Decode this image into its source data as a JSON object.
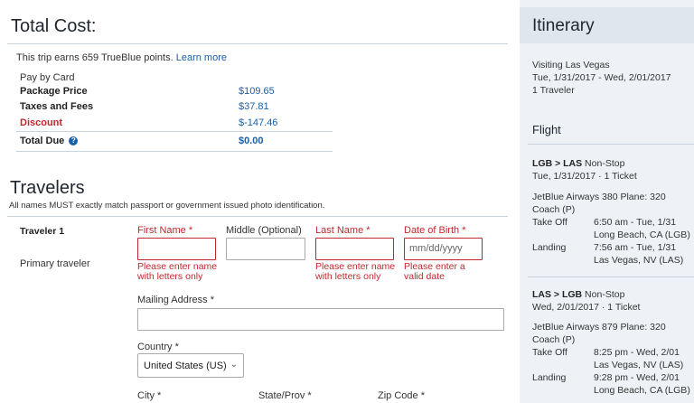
{
  "total": {
    "heading": "Total Cost:",
    "earn_text": "This trip earns 659 TrueBlue points.",
    "learn_more": "Learn more",
    "pay_by": "Pay by Card",
    "package_label": "Package Price",
    "package_value": "$109.65",
    "taxes_label": "Taxes and Fees",
    "taxes_value": "$37.81",
    "discount_label": "Discount",
    "discount_value": "$-147.46",
    "due_label": "Total Due",
    "due_value": "$0.00",
    "info_icon": "?"
  },
  "travelers": {
    "heading": "Travelers",
    "note": "All names MUST exactly match passport or government issued photo identification.",
    "traveler_label": "Traveler 1",
    "traveler_sub": "Primary traveler",
    "first_name_label": "First Name *",
    "middle_label": "Middle (Optional)",
    "last_name_label": "Last Name *",
    "dob_label": "Date of Birth *",
    "dob_placeholder": "mm/dd/yyyy",
    "first_err": "Please enter name with letters only",
    "last_err": "Please enter name with letters only",
    "dob_err": "Please enter a valid date",
    "mailing_label": "Mailing Address *",
    "country_label": "Country *",
    "country_value": "United States (US)",
    "city_label": "City *",
    "state_label": "State/Prov *",
    "zip_label": "Zip Code *"
  },
  "itinerary": {
    "title": "Itinerary",
    "visiting": "Visiting Las Vegas",
    "dates": "Tue, 1/31/2017 - Wed, 2/01/2017",
    "travelers": "1 Traveler",
    "flight_heading": "Flight",
    "segments": [
      {
        "route": "LGB > LAS",
        "stop": " Non-Stop",
        "date": "Tue, 1/31/2017 · 1 Ticket",
        "airline": "JetBlue Airways 380 Plane: 320",
        "cabin": "Coach (P)",
        "takeoff_label": "Take Off",
        "takeoff_time": "6:50 am - Tue, 1/31",
        "takeoff_place": "Long Beach, CA (LGB)",
        "landing_label": "Landing",
        "landing_time": "7:56 am - Tue, 1/31",
        "landing_place": "Las Vegas, NV (LAS)"
      },
      {
        "route": "LAS > LGB",
        "stop": " Non-Stop",
        "date": "Wed, 2/01/2017 · 1 Ticket",
        "airline": "JetBlue Airways 879 Plane: 320",
        "cabin": "Coach (P)",
        "takeoff_label": "Take Off",
        "takeoff_time": "8:25 pm - Wed, 2/01",
        "takeoff_place": "Las Vegas, NV (LAS)",
        "landing_label": "Landing",
        "landing_time": "9:28 pm - Wed, 2/01",
        "landing_place": "Long Beach, CA (LGB)"
      }
    ]
  },
  "colors": {
    "link": "#1a5fa8",
    "error": "#c0282e",
    "sidebar": "#eef2f6"
  }
}
